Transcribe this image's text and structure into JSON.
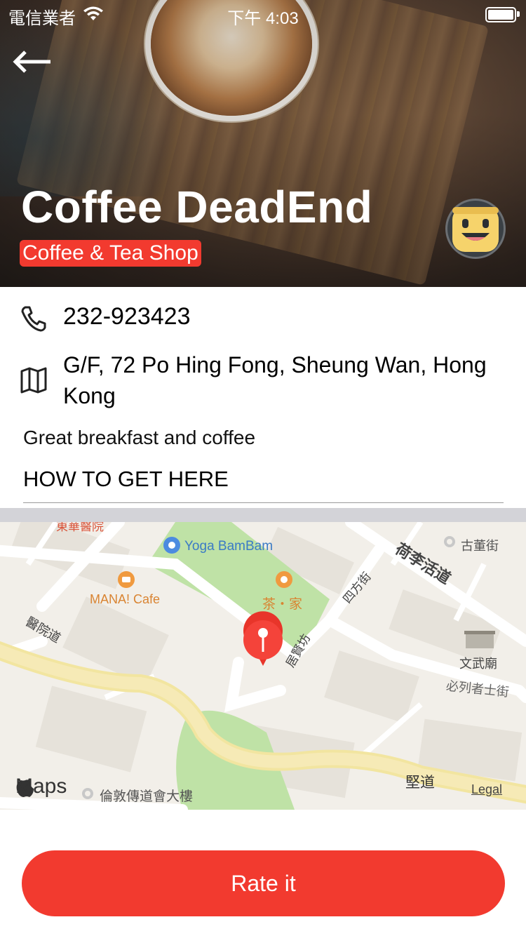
{
  "status_bar": {
    "carrier": "電信業者",
    "time": "下午 4:03"
  },
  "hero": {
    "title": "Coffee DeadEnd",
    "category": "Coffee & Tea Shop"
  },
  "info": {
    "phone": "232-923423",
    "address": "G/F, 72 Po Hing Fong, Sheung Wan, Hong Kong",
    "description": "Great breakfast and coffee",
    "section_heading": "HOW TO GET HERE"
  },
  "map": {
    "labels": {
      "yoga": "Yoga BamBam",
      "mana": "MANA! Cafe",
      "cha": "茶・家",
      "dong": "東華醫院",
      "gudong": "古董街",
      "wenwu": "文武廟",
      "bilie": "必列者士街",
      "hollywood": "荷李活道",
      "sifang": "四方街",
      "juxian": "居賢坊",
      "yiyuan": "醫院道",
      "jiandao": "堅道",
      "lundun": "倫敦傳道會大樓",
      "legal": "Legal",
      "maps": "Maps"
    }
  },
  "actions": {
    "rate_label": "Rate it"
  },
  "colors": {
    "accent": "#f23a2f"
  }
}
